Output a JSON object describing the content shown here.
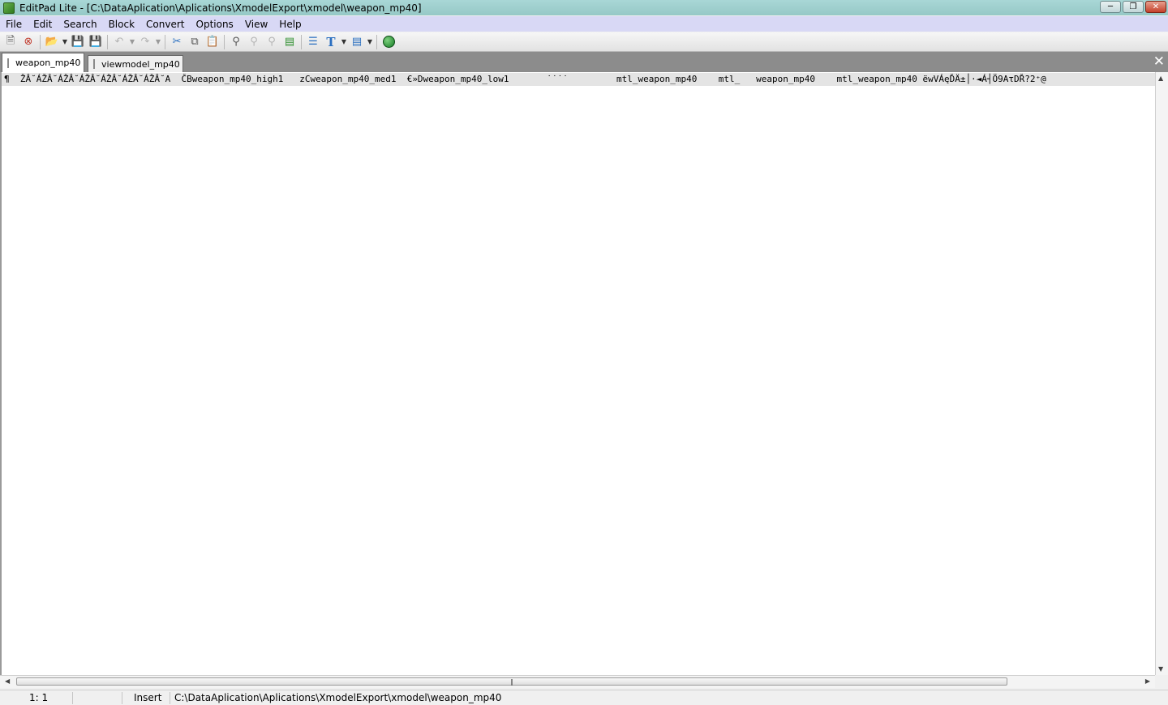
{
  "window": {
    "title": "EditPad Lite - [C:\\DataAplication\\Aplications\\XmodelExport\\xmodel\\weapon_mp40]"
  },
  "menu": {
    "items": [
      "File",
      "Edit",
      "Search",
      "Block",
      "Convert",
      "Options",
      "View",
      "Help"
    ]
  },
  "toolbar": {
    "icons": [
      "new-file-icon",
      "close-file-icon",
      "open-file-icon",
      "save-icon",
      "save-all-icon",
      "undo-icon",
      "redo-icon",
      "cut-icon",
      "copy-icon",
      "paste-icon",
      "search-icon",
      "find-next-icon",
      "find-previous-icon",
      "replace-icon",
      "insert-file-icon",
      "font-icon",
      "view-icon",
      "web-icon"
    ]
  },
  "tabs": [
    {
      "label": "weapon_mp40",
      "active": true
    },
    {
      "label": "viewmodel_mp40",
      "active": false
    }
  ],
  "editor": {
    "line1": "¶  ŽÂ˘ÁŽÂ˘ÁŽÂ˘ÁŽÂ˘ÁŽÂ˘ÁŽÂ˘ÁŽÂ˘A  ČBweapon_mp40_high1   zCweapon_mp40_med1  €»Dweapon_mp40_low1       ˙˙˙˙         mtl_weapon_mp40    mtl_   weapon_mp40    mtl_weapon_mp40 ëwVÁęĎÄ±│·◄Á┤Ö9ΑτDŘ?2⁺@"
  },
  "status": {
    "position": "1: 1",
    "mode": "Insert",
    "path": "C:\\DataAplication\\Aplications\\XmodelExport\\xmodel\\weapon_mp40"
  },
  "colors": {
    "titlebar": "#a9d7d6",
    "menubar": "#d8d8f5",
    "tabbar": "#8c8c8c",
    "current_line": "#e4e4e4"
  }
}
